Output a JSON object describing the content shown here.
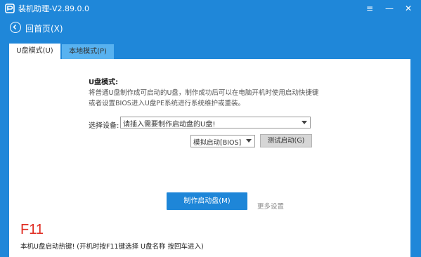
{
  "app": {
    "title": "装机助理-V2.89.0.0",
    "menu_icon": "≡",
    "minimize_icon": "—",
    "close_icon": "✕"
  },
  "nav": {
    "back_label": "回首页(X)"
  },
  "tabs": [
    {
      "label": "U盘模式(U)",
      "active": true
    },
    {
      "label": "本地模式(P)",
      "active": false
    }
  ],
  "usb_mode": {
    "title": "U盘模式:",
    "description": "将普通U盘制作成可启动的U盘，制作成功后可以在电脑开机时使用启动快捷键或者设置BIOS进入U盘PE系统进行系统维护或重装。",
    "device_label": "选择设备:",
    "device_value": "请插入需要制作启动盘的U盘!",
    "sim_boot_value": "模拟启动[BIOS]",
    "test_button": "测试启动(G)",
    "make_button": "制作启动盘(M)",
    "more_settings": "更多设置"
  },
  "hotkey": {
    "key": "F11",
    "description": "本机U盘启动热键! (开机时按F11键选择 U盘名称 按回车进入)"
  },
  "colors": {
    "background": "#1f87d9",
    "accent": "#1e86d8",
    "hotkey": "#e02b20"
  }
}
